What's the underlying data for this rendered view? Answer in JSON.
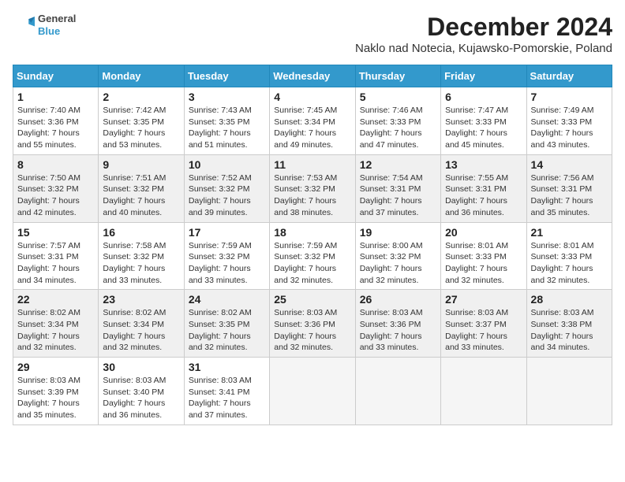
{
  "header": {
    "logo_line1": "General",
    "logo_line2": "Blue",
    "title": "December 2024",
    "subtitle": "Naklo nad Notecia, Kujawsko-Pomorskie, Poland"
  },
  "days_of_week": [
    "Sunday",
    "Monday",
    "Tuesday",
    "Wednesday",
    "Thursday",
    "Friday",
    "Saturday"
  ],
  "weeks": [
    [
      {
        "day": 1,
        "info": "Sunrise: 7:40 AM\nSunset: 3:36 PM\nDaylight: 7 hours\nand 55 minutes."
      },
      {
        "day": 2,
        "info": "Sunrise: 7:42 AM\nSunset: 3:35 PM\nDaylight: 7 hours\nand 53 minutes."
      },
      {
        "day": 3,
        "info": "Sunrise: 7:43 AM\nSunset: 3:35 PM\nDaylight: 7 hours\nand 51 minutes."
      },
      {
        "day": 4,
        "info": "Sunrise: 7:45 AM\nSunset: 3:34 PM\nDaylight: 7 hours\nand 49 minutes."
      },
      {
        "day": 5,
        "info": "Sunrise: 7:46 AM\nSunset: 3:33 PM\nDaylight: 7 hours\nand 47 minutes."
      },
      {
        "day": 6,
        "info": "Sunrise: 7:47 AM\nSunset: 3:33 PM\nDaylight: 7 hours\nand 45 minutes."
      },
      {
        "day": 7,
        "info": "Sunrise: 7:49 AM\nSunset: 3:33 PM\nDaylight: 7 hours\nand 43 minutes."
      }
    ],
    [
      {
        "day": 8,
        "info": "Sunrise: 7:50 AM\nSunset: 3:32 PM\nDaylight: 7 hours\nand 42 minutes."
      },
      {
        "day": 9,
        "info": "Sunrise: 7:51 AM\nSunset: 3:32 PM\nDaylight: 7 hours\nand 40 minutes."
      },
      {
        "day": 10,
        "info": "Sunrise: 7:52 AM\nSunset: 3:32 PM\nDaylight: 7 hours\nand 39 minutes."
      },
      {
        "day": 11,
        "info": "Sunrise: 7:53 AM\nSunset: 3:32 PM\nDaylight: 7 hours\nand 38 minutes."
      },
      {
        "day": 12,
        "info": "Sunrise: 7:54 AM\nSunset: 3:31 PM\nDaylight: 7 hours\nand 37 minutes."
      },
      {
        "day": 13,
        "info": "Sunrise: 7:55 AM\nSunset: 3:31 PM\nDaylight: 7 hours\nand 36 minutes."
      },
      {
        "day": 14,
        "info": "Sunrise: 7:56 AM\nSunset: 3:31 PM\nDaylight: 7 hours\nand 35 minutes."
      }
    ],
    [
      {
        "day": 15,
        "info": "Sunrise: 7:57 AM\nSunset: 3:31 PM\nDaylight: 7 hours\nand 34 minutes."
      },
      {
        "day": 16,
        "info": "Sunrise: 7:58 AM\nSunset: 3:32 PM\nDaylight: 7 hours\nand 33 minutes."
      },
      {
        "day": 17,
        "info": "Sunrise: 7:59 AM\nSunset: 3:32 PM\nDaylight: 7 hours\nand 33 minutes."
      },
      {
        "day": 18,
        "info": "Sunrise: 7:59 AM\nSunset: 3:32 PM\nDaylight: 7 hours\nand 32 minutes."
      },
      {
        "day": 19,
        "info": "Sunrise: 8:00 AM\nSunset: 3:32 PM\nDaylight: 7 hours\nand 32 minutes."
      },
      {
        "day": 20,
        "info": "Sunrise: 8:01 AM\nSunset: 3:33 PM\nDaylight: 7 hours\nand 32 minutes."
      },
      {
        "day": 21,
        "info": "Sunrise: 8:01 AM\nSunset: 3:33 PM\nDaylight: 7 hours\nand 32 minutes."
      }
    ],
    [
      {
        "day": 22,
        "info": "Sunrise: 8:02 AM\nSunset: 3:34 PM\nDaylight: 7 hours\nand 32 minutes."
      },
      {
        "day": 23,
        "info": "Sunrise: 8:02 AM\nSunset: 3:34 PM\nDaylight: 7 hours\nand 32 minutes."
      },
      {
        "day": 24,
        "info": "Sunrise: 8:02 AM\nSunset: 3:35 PM\nDaylight: 7 hours\nand 32 minutes."
      },
      {
        "day": 25,
        "info": "Sunrise: 8:03 AM\nSunset: 3:36 PM\nDaylight: 7 hours\nand 32 minutes."
      },
      {
        "day": 26,
        "info": "Sunrise: 8:03 AM\nSunset: 3:36 PM\nDaylight: 7 hours\nand 33 minutes."
      },
      {
        "day": 27,
        "info": "Sunrise: 8:03 AM\nSunset: 3:37 PM\nDaylight: 7 hours\nand 33 minutes."
      },
      {
        "day": 28,
        "info": "Sunrise: 8:03 AM\nSunset: 3:38 PM\nDaylight: 7 hours\nand 34 minutes."
      }
    ],
    [
      {
        "day": 29,
        "info": "Sunrise: 8:03 AM\nSunset: 3:39 PM\nDaylight: 7 hours\nand 35 minutes."
      },
      {
        "day": 30,
        "info": "Sunrise: 8:03 AM\nSunset: 3:40 PM\nDaylight: 7 hours\nand 36 minutes."
      },
      {
        "day": 31,
        "info": "Sunrise: 8:03 AM\nSunset: 3:41 PM\nDaylight: 7 hours\nand 37 minutes."
      },
      null,
      null,
      null,
      null
    ]
  ]
}
